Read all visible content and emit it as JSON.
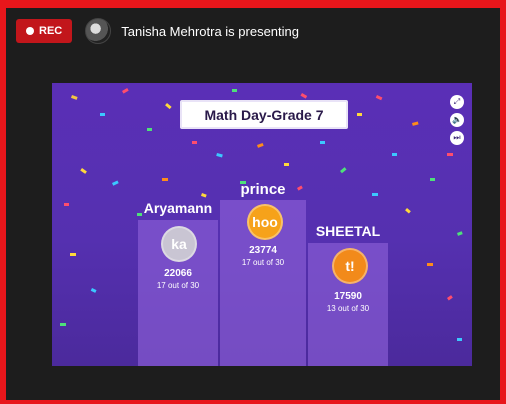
{
  "recording": {
    "label": "REC",
    "color": "#c2161b"
  },
  "presenter": {
    "text": "Tanisha Mehrotra is presenting"
  },
  "quiz": {
    "title": "Math Day-Grade 7",
    "controls": [
      {
        "icon": "fullscreen-icon",
        "glyph": "⤢"
      },
      {
        "icon": "volume-icon",
        "glyph": "🔈"
      },
      {
        "icon": "skip-icon",
        "glyph": "⏭"
      }
    ],
    "podium": [
      {
        "name": "Aryamann",
        "initials": "ka",
        "score": "22066",
        "correct": "17 out of 30",
        "badge_color": "#c9c5d3"
      },
      {
        "name": "prince",
        "initials": "hoo",
        "score": "23774",
        "correct": "17 out of 30",
        "badge_color": "#f6a21a"
      },
      {
        "name": "SHEETAL",
        "initials": "t!",
        "score": "17590",
        "correct": "13 out of 30",
        "badge_color": "#f28a1a"
      }
    ]
  },
  "colors": {
    "accent_border": "#e8161b",
    "stage_bg": "#5530b0",
    "pillar": "#8c5fd7"
  }
}
